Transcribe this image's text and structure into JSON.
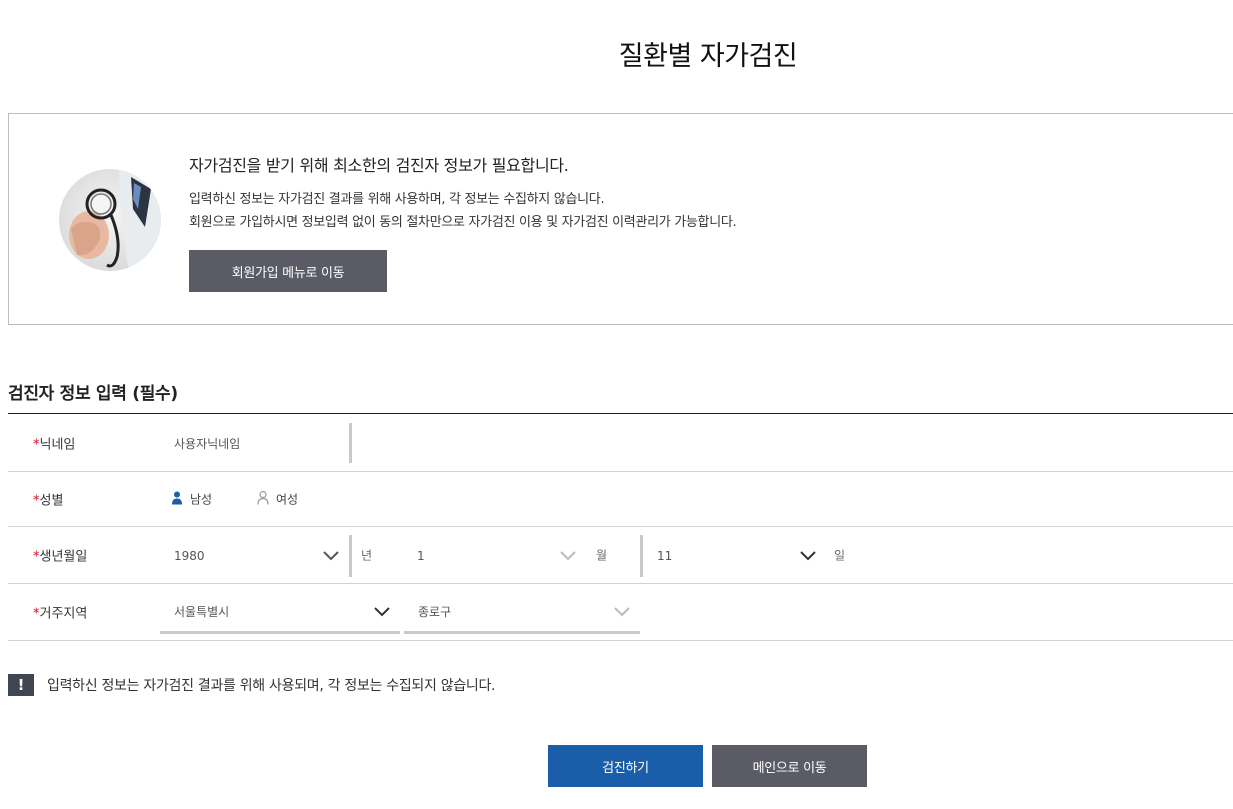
{
  "page": {
    "title": "질환별 자가검진"
  },
  "intro": {
    "heading": "자가검진을 받기 위해 최소한의 검진자 정보가 필요합니다.",
    "line1": "입력하신 정보는 자가검진 결과를 위해 사용하며, 각 정보는 수집하지 않습니다.",
    "line2": "회원으로 가입하시면 정보입력 없이 동의 절차만으로 자가검진 이용 및 자가검진 이력관리가 가능합니다.",
    "join_button": "회원가입 메뉴로 이동"
  },
  "form": {
    "section_title": "검진자 정보 입력 (필수)",
    "required_mark": "*",
    "nickname": {
      "label": "닉네임",
      "value": "사용자닉네임"
    },
    "gender": {
      "label": "성별",
      "options": [
        "남성",
        "여성"
      ]
    },
    "birth": {
      "label": "생년월일",
      "year": "1980",
      "year_suffix": "년",
      "month": "1",
      "month_suffix": "월",
      "day": "11",
      "day_suffix": "일"
    },
    "region": {
      "label": "거주지역",
      "province": "서울특별시",
      "district": "종로구"
    }
  },
  "notice": {
    "icon": "!",
    "text": "입력하신 정보는 자가검진 결과를 위해 사용되며, 각 정보는 수집되지 않습니다."
  },
  "buttons": {
    "submit": "검진하기",
    "main": "메인으로 이동"
  },
  "colors": {
    "primary": "#1a5eaa",
    "secondary": "#5b5b65",
    "required": "#d0021b"
  }
}
